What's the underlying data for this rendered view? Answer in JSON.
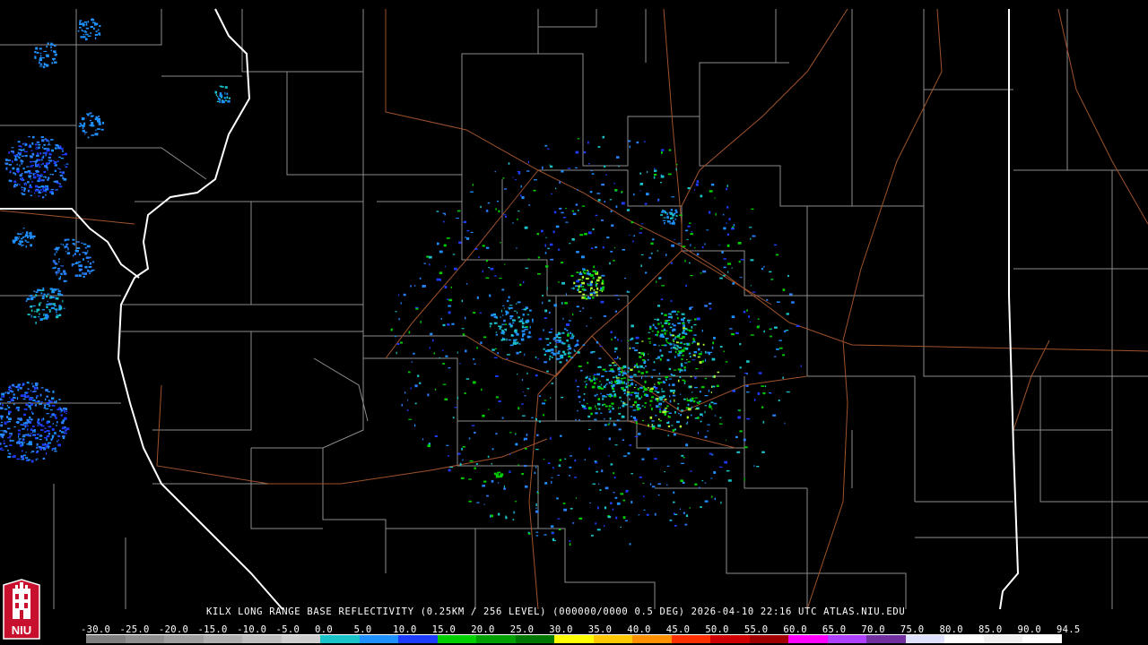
{
  "product": {
    "caption": "KILX LONG RANGE BASE REFLECTIVITY (0.25KM / 256 LEVEL) (000000/0000 0.5 DEG) 2026-04-10 22:16 UTC  ATLAS.NIU.EDU"
  },
  "logo": {
    "text": "NIU",
    "icon": "university-tower-logo"
  },
  "scale": {
    "labels": [
      "-30.0",
      "-25.0",
      "-20.0",
      "-15.0",
      "-10.0",
      "-5.0",
      "0.0",
      "5.0",
      "10.0",
      "15.0",
      "20.0",
      "25.0",
      "30.0",
      "35.0",
      "40.0",
      "45.0",
      "50.0",
      "55.0",
      "60.0",
      "65.0",
      "70.0",
      "75.0",
      "80.0",
      "85.0",
      "90.0",
      "94.5"
    ],
    "colors": [
      "#7f7f7f",
      "#8f8f8f",
      "#9f9f9f",
      "#afafaf",
      "#bfbfbf",
      "#cfcfcf",
      "#19c3c8",
      "#1e90ff",
      "#1e3cff",
      "#00d000",
      "#00a000",
      "#007800",
      "#ffff00",
      "#ffc800",
      "#ff9000",
      "#ff3000",
      "#d00000",
      "#a00000",
      "#ff00ff",
      "#b040ff",
      "#7030a0",
      "#e0e0ff",
      "#ffffff",
      "#f0f0f0",
      "#ffffff"
    ]
  },
  "colors": {
    "background": "#000000",
    "county_lines": "#8c8c8c",
    "state_lines": "#ffffff",
    "highways": "#a0522d"
  }
}
